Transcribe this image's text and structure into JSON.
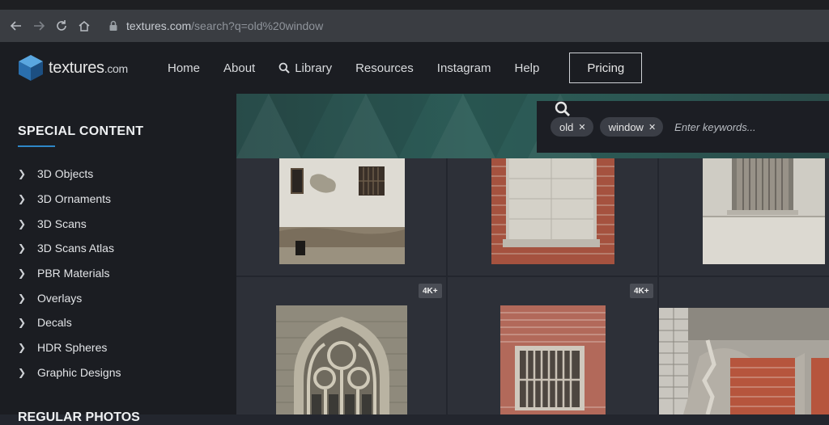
{
  "browser": {
    "url_host": "textures.com",
    "url_path": "/search?q=old%20window"
  },
  "logo": {
    "text": "textures",
    "domain": ".com"
  },
  "nav": {
    "items": [
      "Home",
      "About",
      "Library",
      "Resources",
      "Instagram",
      "Help"
    ],
    "pricing": "Pricing"
  },
  "sidebar": {
    "heading": "SPECIAL CONTENT",
    "items": [
      "3D Objects",
      "3D Ornaments",
      "3D Scans",
      "3D Scans Atlas",
      "PBR Materials",
      "Overlays",
      "Decals",
      "HDR Spheres",
      "Graphic Designs"
    ],
    "heading2": "REGULAR PHOTOS"
  },
  "search": {
    "tags": [
      "old",
      "window"
    ],
    "placeholder": "Enter keywords..."
  },
  "results": {
    "badges": [
      "4K+",
      "4K+"
    ]
  },
  "colors": {
    "accent": "#2e87c8",
    "header_bg": "#1b1d22",
    "main_bg": "#2d3038"
  }
}
